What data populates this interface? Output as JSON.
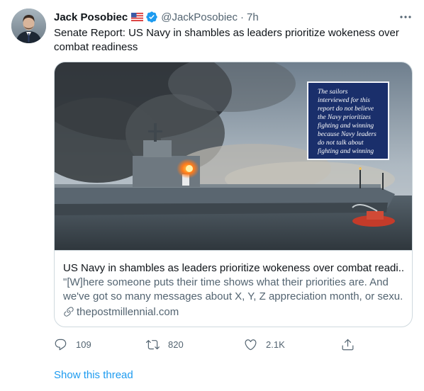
{
  "tweet": {
    "author_name": "Jack Posobiec",
    "author_handle": "@JackPosobiec",
    "separator": "·",
    "time": "7h",
    "text_line1": "Senate Report: US Navy in shambles as leaders prioritize wokeness over",
    "text_line2": "combat readiness",
    "icons": {
      "flag": "us-flag-icon",
      "verified": "verified-badge-icon",
      "more": "more-options-icon"
    },
    "colors": {
      "verified": "#1d9bf0",
      "link": "#1d9bf0",
      "muted": "#536471"
    }
  },
  "card": {
    "title": "US Navy in shambles as leaders prioritize wokeness over combat readi...",
    "description_line1": "\"[W]here someone puts their time shows what their priorities are. And",
    "description_line2": "we've got so many messages about X, Y, Z appreciation month, or sexu...",
    "domain": "thepostmillennial.com",
    "image_quote_lines": [
      "The sailors",
      "interviewed for this",
      "report do not believe",
      "the Navy prioritizes",
      "fighting and winning",
      "because Navy leaders",
      "do not talk about",
      "fighting and winning"
    ]
  },
  "actions": {
    "replies": "109",
    "retweets": "820",
    "likes": "2.1K"
  },
  "show_thread": "Show this thread"
}
